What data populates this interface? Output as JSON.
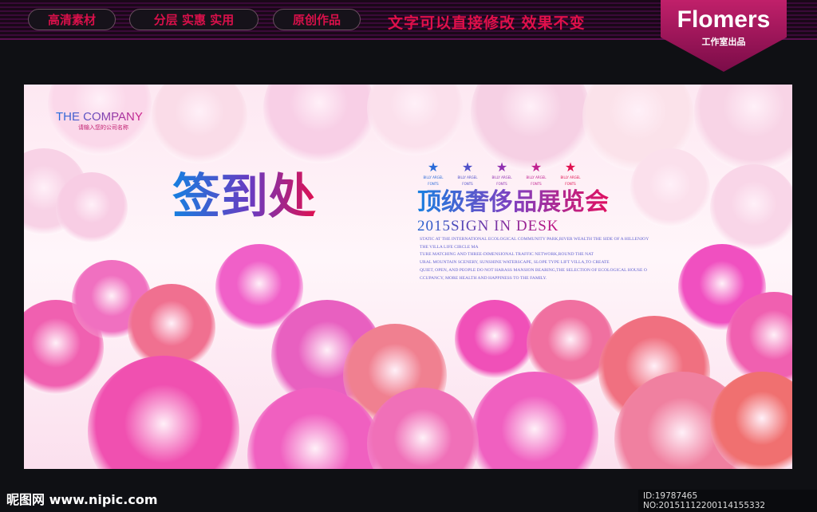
{
  "header": {
    "pills": [
      "高清素材",
      "分层 实惠 实用",
      "原创作品"
    ],
    "slogan": "文字可以直接修改 效果不变",
    "brand": "Flomers",
    "brand_sub": "工作室出品"
  },
  "poster": {
    "company": "THE COMPANY",
    "company_sub": "请输入您的公司名称",
    "title": "签到处",
    "subtitle": "顶级奢侈品展览会",
    "year_line": "2015SIGN IN DESK",
    "stars": [
      {
        "label": "BILLY ARGEL FONTS",
        "color": "#2a6ad8"
      },
      {
        "label": "BILLY ARGEL FONTS",
        "color": "#5050c8"
      },
      {
        "label": "BILLY ARGEL FONTS",
        "color": "#9030b0"
      },
      {
        "label": "BILLY ARGEL FONTS",
        "color": "#c02090"
      },
      {
        "label": "BILLY ARGEL FONTS",
        "color": "#e01050"
      }
    ],
    "description": [
      "STATIC AT THE INTERNATIONAL ECOLOGICAL COMMUNITY PARK,RIVER WEALTH THE SIDE OF A HILLENJOY",
      "THE VILLA LIFE CIRCLE MA",
      "TURE MATCHING AND THREE-DIMENSIONAL TRAFFIC NETWORK,ROUND THE NAT",
      "URAL MOUNTAIN SCENERY, SUNSHINE WATERSCAPE, SLOPE TYPE LIFT VILLA,TO CREATE",
      "QUIET, OPEN, AND PEOPLE DO NOT HARASS MANSION BEARING,THE SELECTION OF ECOLOGICAL HOUSE O",
      "CCUPANCY, MORE HEALTH AND HAPPINESS TO THE FAMILY."
    ]
  },
  "footer": {
    "site": "昵图网 www.nipic.com",
    "id": "ID:19787465 NO:20151112200114155332"
  }
}
